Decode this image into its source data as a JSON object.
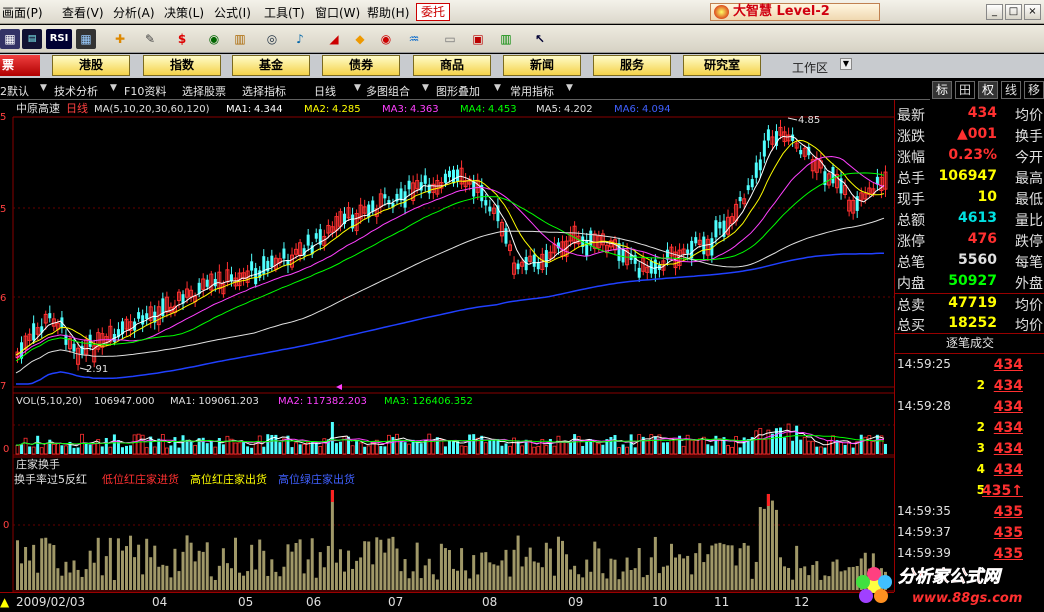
{
  "menu": [
    "画面(P)",
    "查看(V)",
    "分析(A)",
    "决策(L)",
    "公式(I)",
    "工具(T)",
    "窗口(W)",
    "帮助(H)"
  ],
  "entrust": "委托",
  "brand": "大智慧 Level-2",
  "toolbar_icons": [
    "rsi-icon",
    "chart-icon",
    "crosshair-icon",
    "ruler-icon",
    "yuan-icon",
    "bars-icon",
    "binoculars-icon",
    "bell-icon",
    "diamond-icon",
    "target-icon",
    "link-icon",
    "cursor-help-icon"
  ],
  "rsi_label": "RSI",
  "yuan_label": "$",
  "nav": {
    "first": "票",
    "items": [
      "港股",
      "指数",
      "基金",
      "债券",
      "商品",
      "新闻",
      "服务",
      "研究室"
    ],
    "workarea": "工作区"
  },
  "options": [
    "2默认",
    "技术分析",
    "F10资料",
    "选择股票",
    "选择指标",
    "日线",
    "多图组合",
    "图形叠加",
    "常用指标"
  ],
  "sidetabs": [
    "标",
    "田",
    "权",
    "线",
    "移"
  ],
  "main": {
    "title": "中原高速",
    "period": "日线",
    "ma_label": "MA(5,10,20,30,60,120)",
    "ma": [
      {
        "name": "MA1:",
        "value": "4.344",
        "color": "#ffffff"
      },
      {
        "name": "MA2:",
        "value": "4.285",
        "color": "#ffff00"
      },
      {
        "name": "MA3:",
        "value": "4.363",
        "color": "#ff40ff"
      },
      {
        "name": "MA4:",
        "value": "4.453",
        "color": "#00ff00"
      },
      {
        "name": "MA5:",
        "value": "4.202",
        "color": "#e0e0e0"
      },
      {
        "name": "MA6:",
        "value": "4.094",
        "color": "#4060ff"
      }
    ],
    "high_label": "4.85",
    "low_label": "2.91",
    "y_labels": [
      "5",
      "5",
      "6",
      "7"
    ]
  },
  "volume": {
    "label": "VOL(5,10,20)",
    "value": "106947.000",
    "ma1": "MA1: 109061.203",
    "ma2": "MA2: 117382.203",
    "ma3": "MA3: 126406.352",
    "y_labels": [
      "0"
    ]
  },
  "turnover": {
    "title": "庄家换手",
    "subtitle": "换手率过5反红",
    "legend": [
      {
        "text": "低位红庄家进货",
        "color": "#ff3030"
      },
      {
        "text": "高位红庄家出货",
        "color": "#ffff00"
      },
      {
        "text": "高位绿庄家出货",
        "color": "#4060ff"
      }
    ],
    "y_labels": [
      "0"
    ]
  },
  "dates": [
    "2009/02/03",
    "04",
    "05",
    "06",
    "07",
    "08",
    "09",
    "10",
    "11",
    "12"
  ],
  "quote": {
    "rows": [
      {
        "label": "最新",
        "value": "434",
        "color": "#ff3030",
        "right": "均价"
      },
      {
        "label": "涨跌",
        "value": "▲001",
        "color": "#ff3030",
        "right": "换手"
      },
      {
        "label": "涨幅",
        "value": "0.23%",
        "color": "#ff3030",
        "right": "今开"
      },
      {
        "label": "总手",
        "value": "106947",
        "color": "#ffff00",
        "right": "最高"
      },
      {
        "label": "现手",
        "value": "10",
        "color": "#ffff00",
        "right": "最低"
      },
      {
        "label": "总额",
        "value": "4613",
        "color": "#00e0e0",
        "right": "量比"
      },
      {
        "label": "涨停",
        "value": "476",
        "color": "#ff3030",
        "right": "跌停"
      },
      {
        "label": "总笔",
        "value": "5560",
        "color": "#e0e0e0",
        "right": "每笔"
      },
      {
        "label": "内盘",
        "value": "50927",
        "color": "#00ff00",
        "right": "外盘"
      },
      {
        "label": "总卖",
        "value": "47719",
        "color": "#ffff00",
        "right": "均价"
      },
      {
        "label": "总买",
        "value": "18252",
        "color": "#ffff00",
        "right": "均价"
      }
    ],
    "trades_title": "逐笔成交",
    "trades": [
      {
        "time": "14:59:25",
        "vol": "",
        "price": "434"
      },
      {
        "time": "",
        "vol": "2",
        "price": "434"
      },
      {
        "time": "14:59:28",
        "vol": "",
        "price": "434"
      },
      {
        "time": "",
        "vol": "2",
        "price": "434"
      },
      {
        "time": "",
        "vol": "3",
        "price": "434"
      },
      {
        "time": "",
        "vol": "4",
        "price": "434"
      },
      {
        "time": "",
        "vol": "5",
        "price": "435↑"
      },
      {
        "time": "14:59:35",
        "vol": "",
        "price": "435"
      },
      {
        "time": "14:59:37",
        "vol": "",
        "price": "435"
      },
      {
        "time": "14:59:39",
        "vol": "",
        "price": "435"
      }
    ]
  },
  "watermark": {
    "text": "分析家公式网",
    "url": "www.88gs.com"
  }
}
